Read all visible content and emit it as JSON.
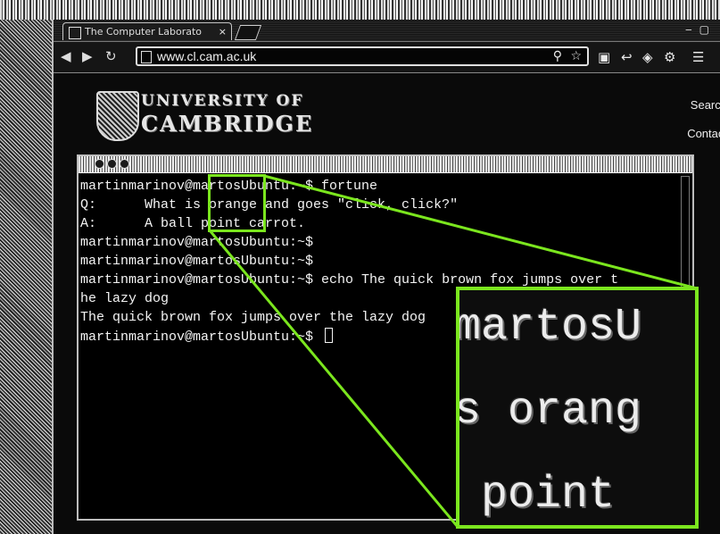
{
  "browser": {
    "tab_title": "The Computer Laborato",
    "tab_close": "×",
    "url": "www.cl.cam.ac.uk",
    "nav_icons": [
      "back-arrow-icon",
      "forward-arrow-icon",
      "reload-icon"
    ]
  },
  "website": {
    "logo_line1": "UNIVERSITY OF",
    "logo_line2": "CAMBRIDGE",
    "search_link": "Search",
    "contact_link": "Contact"
  },
  "terminal": {
    "lines": [
      "martinmarinov@martosUbuntu:~$ fortune",
      "Q:      What is orange and goes \"click, click?\"",
      "A:      A ball point carrot.",
      "martinmarinov@martosUbuntu:~$",
      "martinmarinov@martosUbuntu:~$",
      "martinmarinov@martosUbuntu:~$ echo The quick brown fox jumps over t",
      "he lazy dog",
      "The quick brown fox jumps over the lazy dog",
      "martinmarinov@martosUbuntu:~$ "
    ]
  },
  "zoom": {
    "lines": [
      "martosU",
      "s orang",
      " point"
    ],
    "accent_color": "#7be61e"
  }
}
